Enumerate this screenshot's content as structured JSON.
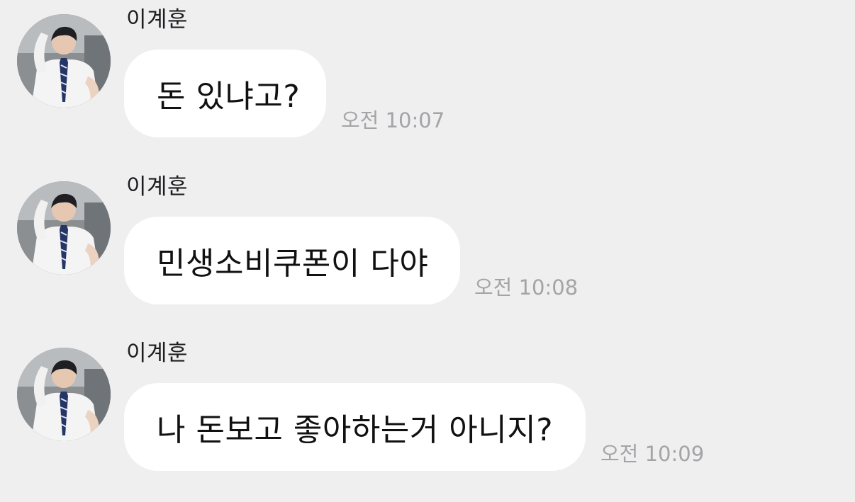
{
  "chat": {
    "messages": [
      {
        "sender": "이계훈",
        "text": "돈 있냐고?",
        "time": "오전 10:07"
      },
      {
        "sender": "이계훈",
        "text": "민생소비쿠폰이 다야",
        "time": "오전 10:08"
      },
      {
        "sender": "이계훈",
        "text": "나 돈보고 좋아하는거 아니지?",
        "time": "오전 10:09"
      }
    ]
  },
  "colors": {
    "background": "#efeff0",
    "bubble": "#ffffff",
    "message_text": "#111111",
    "timestamp": "#a4a4a7"
  },
  "icons": {
    "avatar": "profile-photo"
  }
}
